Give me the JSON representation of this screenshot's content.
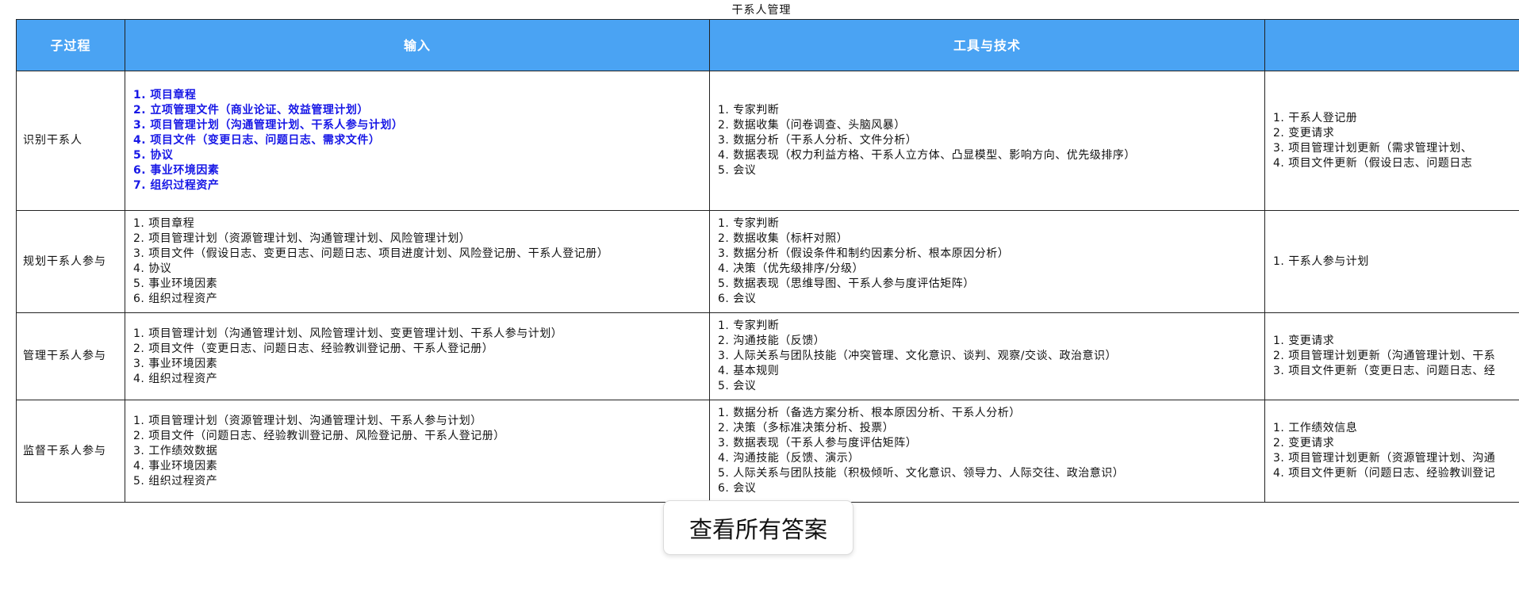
{
  "page": {
    "title": "干系人管理"
  },
  "table": {
    "headers": [
      "子过程",
      "输入",
      "工具与技术",
      ""
    ],
    "rows": [
      {
        "process": "识别干系人",
        "inputs": [
          "1. 项目章程",
          "2. 立项管理文件（商业论证、效益管理计划）",
          "3. 项目管理计划（沟通管理计划、干系人参与计划）",
          "4. 项目文件（变更日志、问题日志、需求文件）",
          "5. 协议",
          "6. 事业环境因素",
          "7. 组织过程资产"
        ],
        "tools": [
          "1. 专家判断",
          "2. 数据收集（问卷调查、头脑风暴）",
          "3. 数据分析（干系人分析、文件分析）",
          "4. 数据表现（权力利益方格、干系人立方体、凸显模型、影响方向、优先级排序）",
          "5. 会议"
        ],
        "outputs": [
          "1. 干系人登记册",
          "2. 变更请求",
          "3. 项目管理计划更新（需求管理计划、",
          "4. 项目文件更新（假设日志、问题日志"
        ]
      },
      {
        "process": "规划干系人参与",
        "inputs": [
          "1. 项目章程",
          "2. 项目管理计划（资源管理计划、沟通管理计划、风险管理计划）",
          "3. 项目文件（假设日志、变更日志、问题日志、项目进度计划、风险登记册、干系人登记册）",
          "4. 协议",
          "5. 事业环境因素",
          "6. 组织过程资产"
        ],
        "tools": [
          "1. 专家判断",
          "2. 数据收集（标杆对照）",
          "3. 数据分析（假设条件和制约因素分析、根本原因分析）",
          "4. 决策（优先级排序/分级）",
          "5. 数据表现（思维导图、干系人参与度评估矩阵）",
          "6. 会议"
        ],
        "outputs": [
          "1. 干系人参与计划"
        ]
      },
      {
        "process": "管理干系人参与",
        "inputs": [
          "1. 项目管理计划（沟通管理计划、风险管理计划、变更管理计划、干系人参与计划）",
          "2. 项目文件（变更日志、问题日志、经验教训登记册、干系人登记册）",
          "3. 事业环境因素",
          "4. 组织过程资产"
        ],
        "tools": [
          "1. 专家判断",
          "2. 沟通技能（反馈）",
          "3. 人际关系与团队技能（冲突管理、文化意识、谈判、观察/交谈、政治意识）",
          "4. 基本规则",
          "5. 会议"
        ],
        "outputs": [
          "1. 变更请求",
          "2. 项目管理计划更新（沟通管理计划、干系",
          "3. 项目文件更新（变更日志、问题日志、经"
        ]
      },
      {
        "process": "监督干系人参与",
        "inputs": [
          "1. 项目管理计划（资源管理计划、沟通管理计划、干系人参与计划）",
          "2. 项目文件（问题日志、经验教训登记册、风险登记册、干系人登记册）",
          "3. 工作绩效数据",
          "4. 事业环境因素",
          "5. 组织过程资产"
        ],
        "tools": [
          "1. 数据分析（备选方案分析、根本原因分析、干系人分析）",
          "2. 决策（多标准决策分析、投票）",
          "3. 数据表现（干系人参与度评估矩阵）",
          "4. 沟通技能（反馈、演示）",
          "5. 人际关系与团队技能（积极倾听、文化意识、领导力、人际交往、政治意识）",
          "6. 会议"
        ],
        "outputs": [
          "1. 工作绩效信息",
          "2. 变更请求",
          "3. 项目管理计划更新（资源管理计划、沟通",
          "4. 项目文件更新（问题日志、经验教训登记"
        ]
      }
    ]
  },
  "actions": {
    "view_all_answers": "查看所有答案"
  },
  "colors": {
    "header_bg": "#4aa3f3",
    "highlight_text": "#1717e6"
  }
}
